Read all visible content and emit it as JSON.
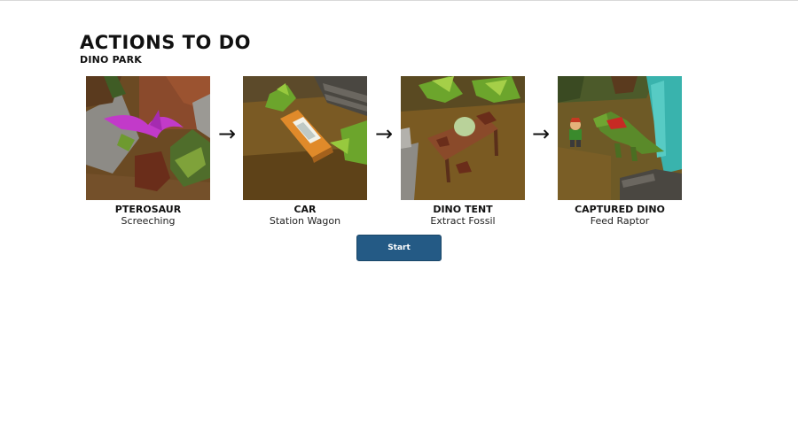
{
  "header": {
    "title": "ACTIONS TO DO",
    "subtitle": "DINO PARK"
  },
  "steps": [
    {
      "name": "PTEROSAUR",
      "action": "Screeching",
      "image": "pterosaur-scene"
    },
    {
      "name": "CAR",
      "action": "Station Wagon",
      "image": "car-scene"
    },
    {
      "name": "DINO TENT",
      "action": "Extract Fossil",
      "image": "dino-tent-scene"
    },
    {
      "name": "CAPTURED DINO",
      "action": "Feed Raptor",
      "image": "captured-dino-scene"
    }
  ],
  "arrows": [
    "→",
    "→",
    "→"
  ],
  "start_button": {
    "label": "Start"
  },
  "colors": {
    "button": "#245a85",
    "text": "#111111",
    "background": "#ffffff"
  }
}
